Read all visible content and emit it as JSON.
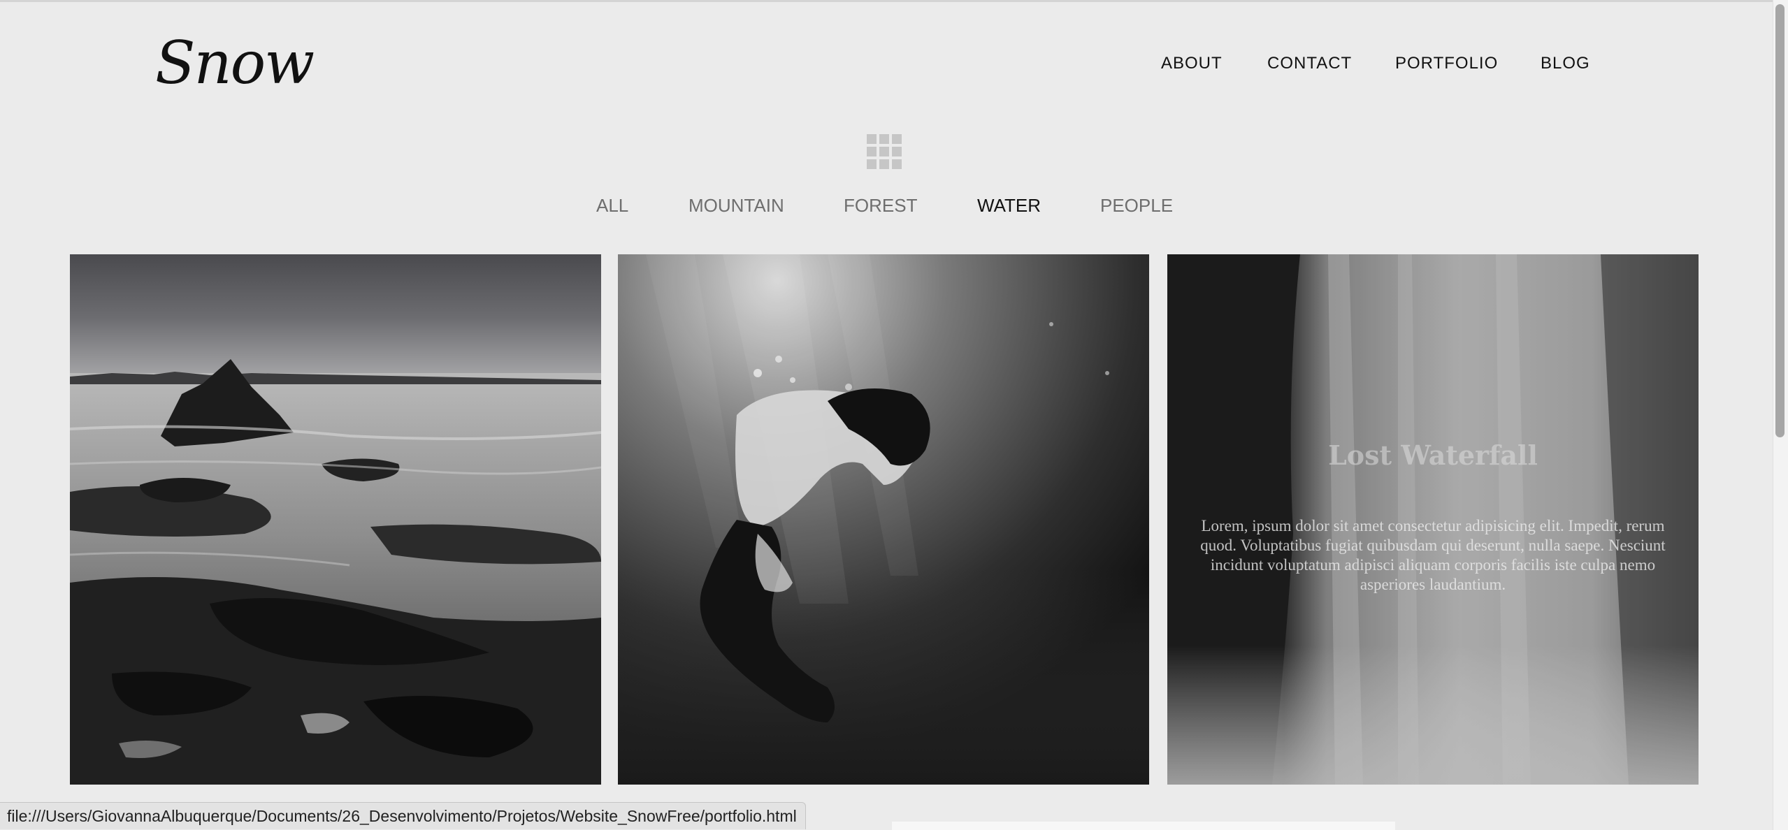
{
  "header": {
    "logo": "Snow",
    "nav": [
      {
        "label": "ABOUT"
      },
      {
        "label": "CONTACT"
      },
      {
        "label": "PORTFOLIO"
      },
      {
        "label": "BLOG"
      }
    ]
  },
  "filters": {
    "icon": "grid-icon",
    "items": [
      {
        "label": "ALL"
      },
      {
        "label": "MOUNTAIN"
      },
      {
        "label": "FOREST"
      },
      {
        "label": "WATER"
      },
      {
        "label": "PEOPLE"
      }
    ],
    "active": "WATER"
  },
  "gallery": {
    "items": [
      {
        "image": "rocky-coast-photo"
      },
      {
        "image": "underwater-diver-photo"
      },
      {
        "image": "waterfall-photo",
        "title": "Lost Waterfall",
        "description": "Lorem, ipsum dolor sit amet consectetur adipisicing elit. Impedit, rerum quod. Voluptatibus fugiat quibusdam qui deserunt, nulla saepe. Nesciunt incidunt voluptatum adipisci aliquam corporis facilis iste culpa nemo asperiores laudantium."
      }
    ]
  },
  "statusbar": {
    "url": "file:///Users/GiovannaAlbuquerque/Documents/26_Desenvolvimento/Projetos/Website_SnowFree/portfolio.html"
  }
}
